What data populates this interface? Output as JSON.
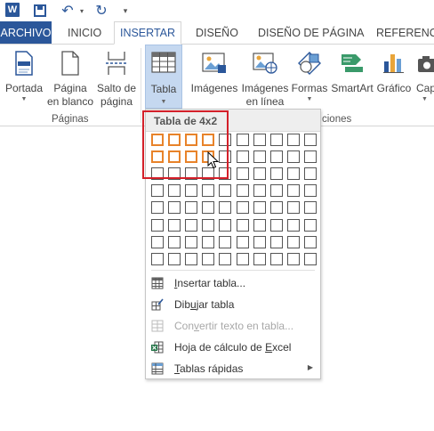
{
  "quick_access": {
    "app_icon": "word-logo",
    "app_letter": "W",
    "save_icon": "save-icon",
    "undo_icon": "undo-icon",
    "redo_icon": "redo-icon"
  },
  "tabs": [
    {
      "label": "ARCHIVO",
      "active": false
    },
    {
      "label": "INICIO",
      "active": false
    },
    {
      "label": "INSERTAR",
      "active": true
    },
    {
      "label": "DISEÑO",
      "active": false
    },
    {
      "label": "DISEÑO DE PÁGINA",
      "active": false
    },
    {
      "label": "REFERENCIA",
      "active": false
    }
  ],
  "ribbon": {
    "portada": {
      "label": "Portada"
    },
    "pagina_en_blanco": {
      "line1": "Página",
      "line2": "en blanco"
    },
    "salto_de_pagina": {
      "line1": "Salto de",
      "line2": "página"
    },
    "tabla": {
      "label": "Tabla"
    },
    "imagenes": {
      "label": "Imágenes"
    },
    "imagenes_en_linea": {
      "line1": "Imágenes",
      "line2": "en línea"
    },
    "formas": {
      "label": "Formas"
    },
    "smartart": {
      "label": "SmartArt"
    },
    "grafico": {
      "label": "Gráfico"
    },
    "captura": {
      "label": "Cap"
    },
    "group_paginas": "Páginas",
    "group_ilustraciones": "ciones"
  },
  "table_dropdown": {
    "header": "Tabla de 4x2",
    "grid_columns": 10,
    "grid_rows": 8,
    "selected_columns": 4,
    "selected_rows": 2,
    "menu": [
      {
        "pre": "",
        "u": "I",
        "post": "nsertar tabla...",
        "icon": "insert-table-icon",
        "disabled": false
      },
      {
        "pre": "Dib",
        "u": "u",
        "post": "jar tabla",
        "icon": "draw-table-icon",
        "disabled": false
      },
      {
        "pre": "Con",
        "u": "v",
        "post": "ertir texto en tabla...",
        "icon": "convert-text-icon",
        "disabled": true
      },
      {
        "pre": "Hoja de cálculo de ",
        "u": "E",
        "post": "xcel",
        "icon": "excel-sheet-icon",
        "disabled": false
      },
      {
        "pre": "",
        "u": "T",
        "post": "ablas rápidas",
        "icon": "quick-tables-icon",
        "disabled": false
      }
    ]
  },
  "colors": {
    "accent": "#2b579a",
    "selection": "#e8832a",
    "highlight": "#d4202a"
  }
}
